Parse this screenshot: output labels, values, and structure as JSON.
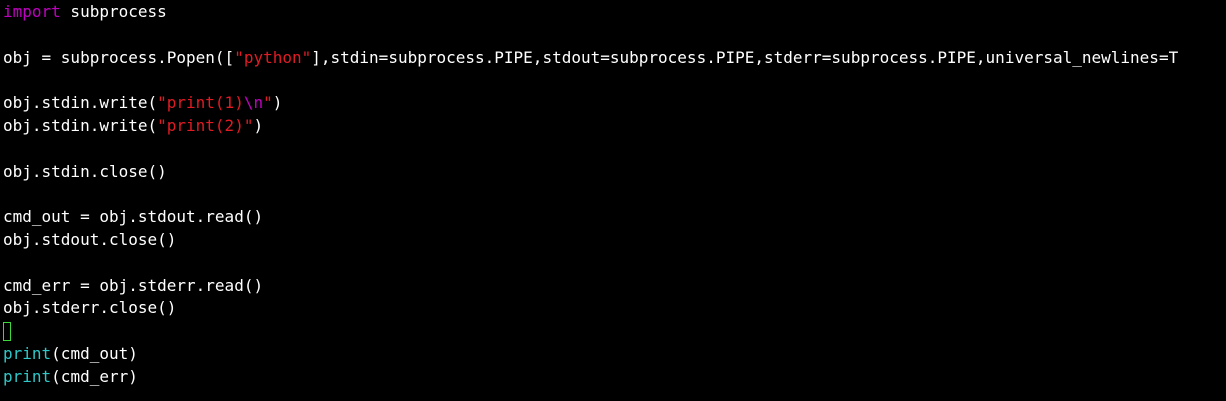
{
  "colors": {
    "background": "#000000",
    "text": "#ffffff",
    "keyword": "#c000c0",
    "string": "#e01b24",
    "escape": "#c000c0",
    "builtin": "#2ec8c8",
    "cursor": "#3cd83c"
  },
  "code": {
    "l1_kw": "import",
    "l1_rest": " subprocess",
    "l3_pre": "obj = subprocess.Popen([",
    "l3_str": "\"python\"",
    "l3_post": "],stdin=subprocess.PIPE,stdout=subprocess.PIPE,stderr=subprocess.PIPE,universal_newlines=T",
    "l5_pre": "obj.stdin.write(",
    "l5_str": "\"print(1)",
    "l5_esc": "\\n",
    "l5_strend": "\"",
    "l5_post": ")",
    "l6_pre": "obj.stdin.write(",
    "l6_str": "\"print(2)\"",
    "l6_post": ")",
    "l8": "obj.stdin.close()",
    "l10": "cmd_out = obj.stdout.read()",
    "l11": "obj.stdout.close()",
    "l13": "cmd_err = obj.stderr.read()",
    "l14": "obj.stderr.close()",
    "l16_fn": "print",
    "l16_rest": "(cmd_out)",
    "l17_fn": "print",
    "l17_rest": "(cmd_err)"
  }
}
